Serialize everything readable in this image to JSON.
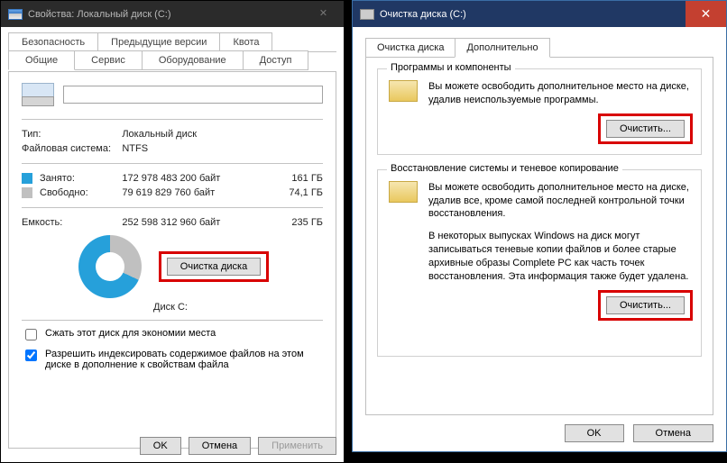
{
  "left": {
    "title": "Свойства: Локальный диск (C:)",
    "tabs_top": [
      "Безопасность",
      "Предыдущие версии",
      "Квота"
    ],
    "tabs_bottom": [
      "Общие",
      "Сервис",
      "Оборудование",
      "Доступ"
    ],
    "drive_name": "",
    "rows": {
      "type_label": "Тип:",
      "type_value": "Локальный диск",
      "fs_label": "Файловая система:",
      "fs_value": "NTFS",
      "used_label": "Занято:",
      "used_bytes": "172 978 483 200 байт",
      "used_gb": "161 ГБ",
      "free_label": "Свободно:",
      "free_bytes": "79 619 829 760 байт",
      "free_gb": "74,1 ГБ",
      "cap_label": "Емкость:",
      "cap_bytes": "252 598 312 960 байт",
      "cap_gb": "235 ГБ",
      "disk_caption": "Диск C:",
      "cleanup_button": "Очистка диска"
    },
    "checks": {
      "compress": "Сжать этот диск для экономии места",
      "index": "Разрешить индексировать содержимое файлов на этом диске в дополнение к свойствам файла"
    },
    "footer": {
      "ok": "OK",
      "cancel": "Отмена",
      "apply": "Применить"
    }
  },
  "right": {
    "title": "Очистка диска  (C:)",
    "tabs": [
      "Очистка диска",
      "Дополнительно"
    ],
    "group1": {
      "legend": "Программы и компоненты",
      "text": "Вы можете освободить дополнительное место на диске, удалив неиспользуемые программы.",
      "button": "Очистить..."
    },
    "group2": {
      "legend": "Восстановление системы и теневое копирование",
      "text1": "Вы можете освободить дополнительное место на диске, удалив все, кроме самой последней контрольной точки восстановления.",
      "text2": "В некоторых выпусках Windows на диск могут записываться теневые копии файлов и более старые архивные образы Complete PC как часть точек восстановления. Эта информация также будет удалена.",
      "button": "Очистить..."
    },
    "footer": {
      "ok": "OK",
      "cancel": "Отмена"
    }
  }
}
